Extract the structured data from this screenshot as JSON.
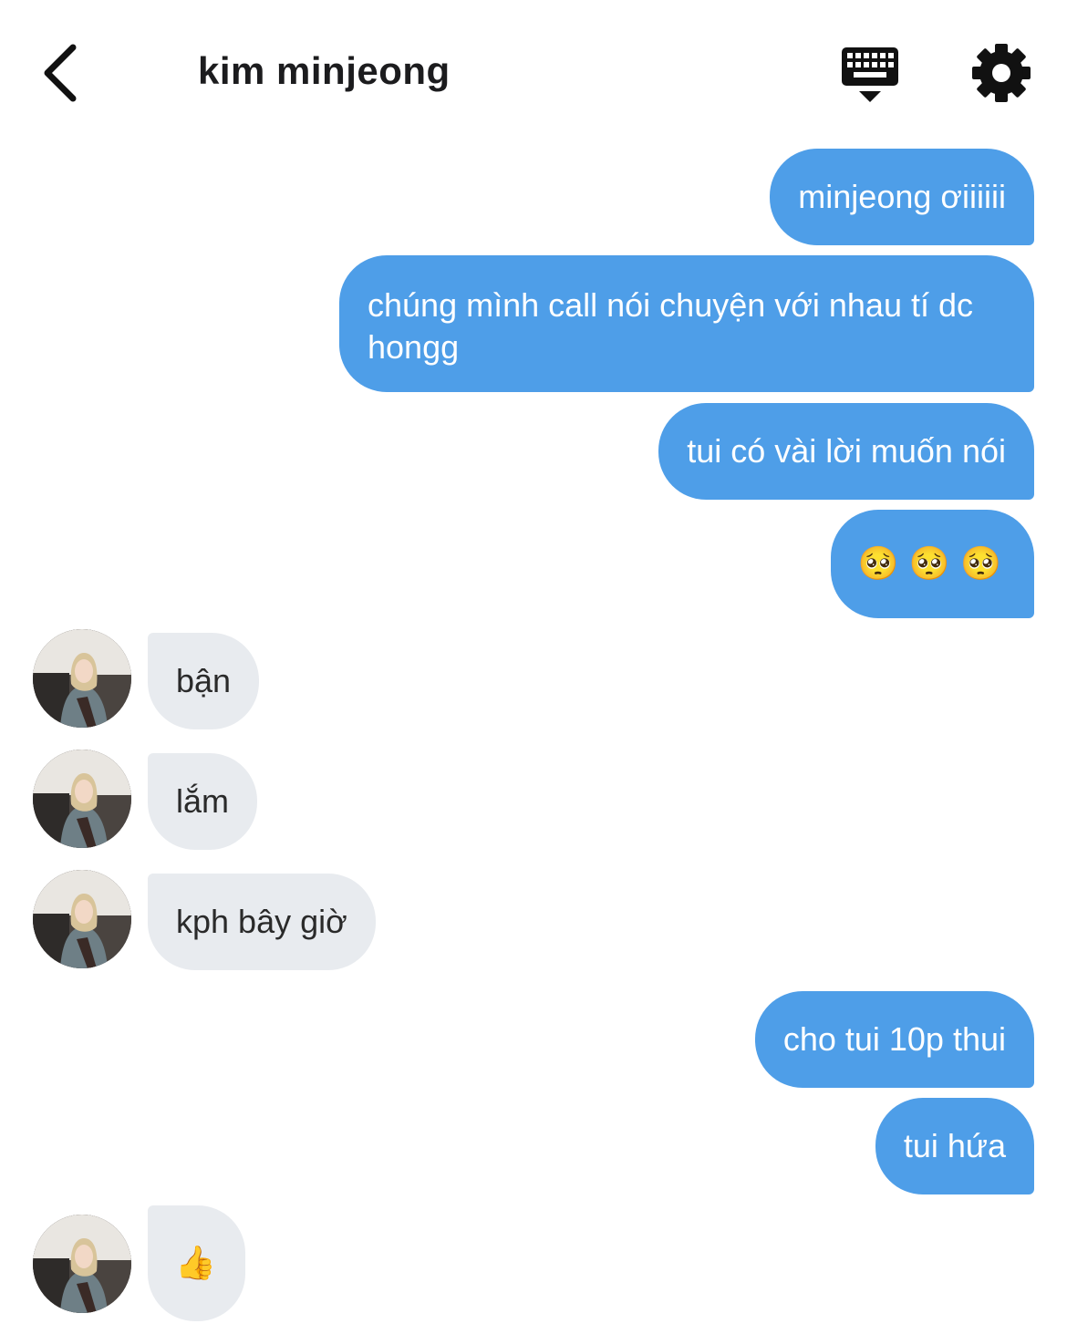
{
  "header": {
    "title": "kim minjeong"
  },
  "colors": {
    "sent_bubble": "#4e9ee8",
    "received_bubble": "#e8ebef",
    "header_icon": "#111111"
  },
  "messages": [
    {
      "from": "me",
      "text": "minjeong ơiiiiii"
    },
    {
      "from": "me",
      "text": "chúng mình call nói chuyện với nhau tí dc hongg"
    },
    {
      "from": "me",
      "text": "tui có vài lời muốn nói"
    },
    {
      "from": "me",
      "text": "🥺 🥺 🥺"
    },
    {
      "from": "them",
      "text": "bận"
    },
    {
      "from": "them",
      "text": "lắm"
    },
    {
      "from": "them",
      "text": "kph bây giờ"
    },
    {
      "from": "me",
      "text": "cho tui 10p thui"
    },
    {
      "from": "me",
      "text": "tui hứa"
    },
    {
      "from": "them",
      "text": "👍"
    }
  ]
}
